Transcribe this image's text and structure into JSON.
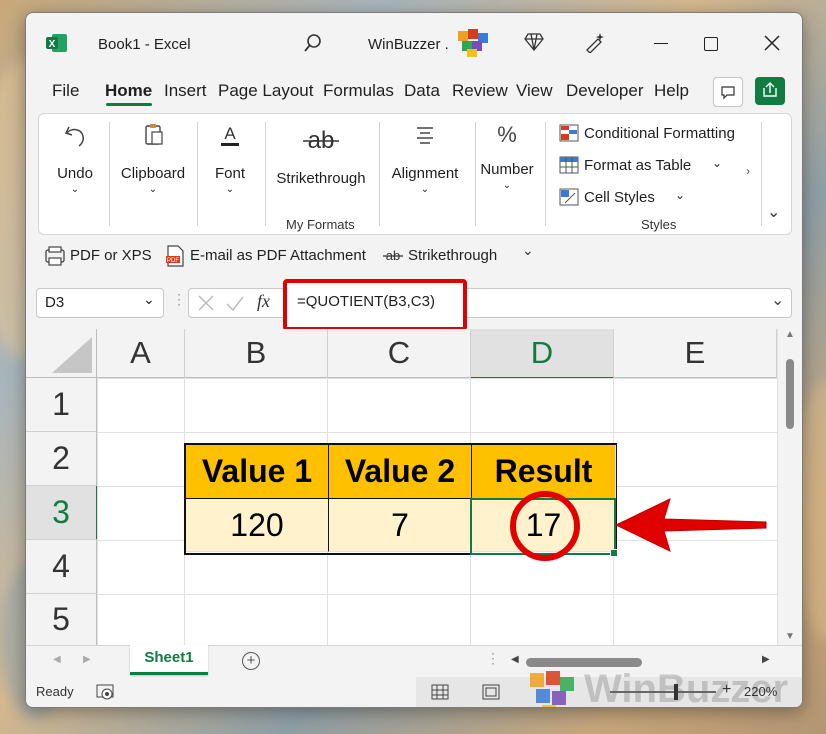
{
  "window": {
    "title": "Book1  -  Excel",
    "account": "WinBuzzer ."
  },
  "menu": {
    "items": [
      "File",
      "Home",
      "Insert",
      "Page Layout",
      "Formulas",
      "Data",
      "Review",
      "View",
      "Developer",
      "Help"
    ],
    "active": "Home"
  },
  "ribbon": {
    "undo": "Undo",
    "clipboard": "Clipboard",
    "font": "Font",
    "strikethrough": "Strikethrough",
    "my_formats": "My Formats",
    "alignment": "Alignment",
    "number": "Number",
    "conditional_formatting": "Conditional Formatting",
    "format_as_table": "Format as Table",
    "cell_styles": "Cell Styles",
    "styles_group": "Styles"
  },
  "quick_access": {
    "pdf_xps": "PDF or XPS",
    "email_pdf": "E-mail as PDF Attachment",
    "strikethrough": "Strikethrough"
  },
  "formula_bar": {
    "name_box": "D3",
    "fx": "fx",
    "formula": "=QUOTIENT(B3,C3)"
  },
  "sheet": {
    "columns": [
      "A",
      "B",
      "C",
      "D",
      "E"
    ],
    "rows": [
      "1",
      "2",
      "3",
      "4",
      "5"
    ],
    "headers": [
      "Value 1",
      "Value 2",
      "Result"
    ],
    "values": [
      "120",
      "7",
      "17"
    ],
    "selected_cell": "D3",
    "colors": {
      "header_fill": "#ffc000",
      "value_fill": "#fff2cc",
      "highlight": "#e00000"
    }
  },
  "tabs": {
    "sheet1": "Sheet1"
  },
  "status": {
    "ready": "Ready",
    "zoom": "220%"
  },
  "watermark": "WinBuzzer"
}
